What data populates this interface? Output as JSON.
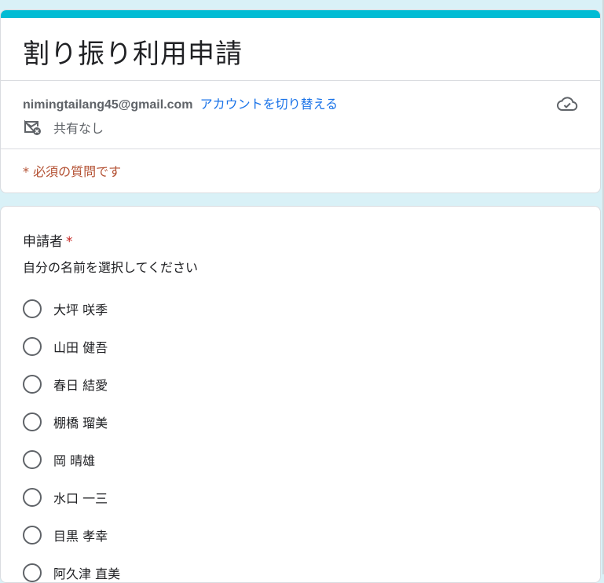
{
  "form": {
    "title": "割り振り利用申請",
    "accent_color": "#00bcd4",
    "account": {
      "email": "nimingtailang45@gmail.com",
      "switch_link": "アカウントを切り替える",
      "saved_icon": "cloud-check-icon"
    },
    "sharing": {
      "icon": "mail-not-shared-icon",
      "text": "共有なし"
    },
    "required_note": "* 必須の質問です"
  },
  "question": {
    "title": "申請者",
    "required_mark": "*",
    "description": "自分の名前を選択してください",
    "options": [
      {
        "label": "大坪 咲季"
      },
      {
        "label": "山田 健吾"
      },
      {
        "label": "春日 結愛"
      },
      {
        "label": "棚橋 瑠美"
      },
      {
        "label": "岡 晴雄"
      },
      {
        "label": "水口 一三"
      },
      {
        "label": "目黒 孝幸"
      },
      {
        "label": "阿久津 直美"
      }
    ]
  }
}
